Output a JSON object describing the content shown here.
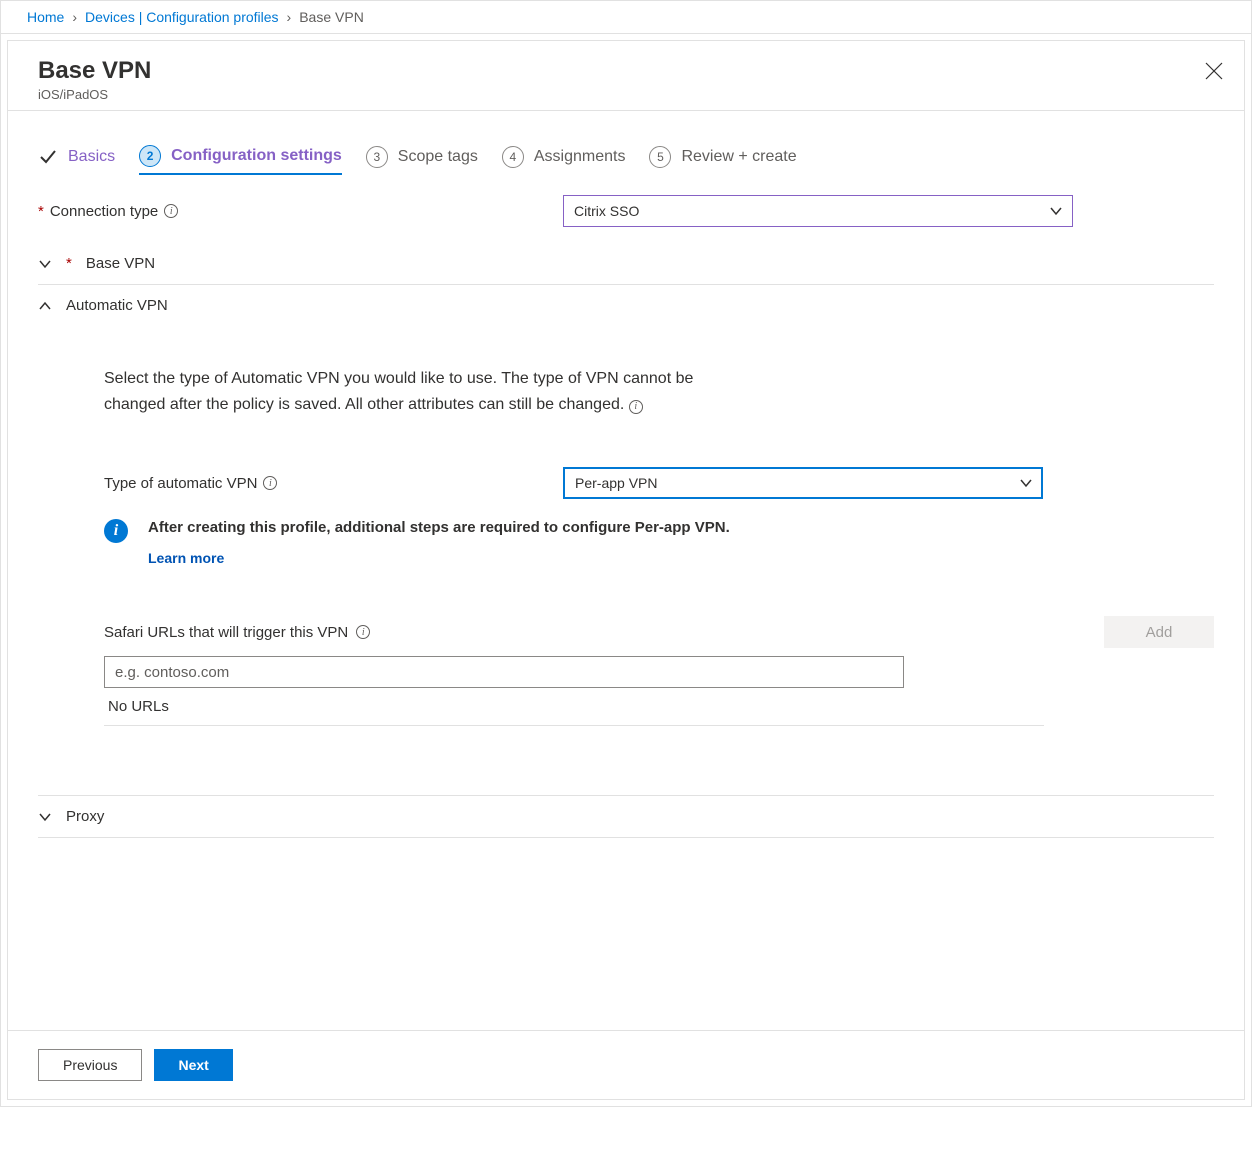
{
  "breadcrumb": {
    "items": [
      "Home",
      "Devices | Configuration profiles"
    ],
    "current": "Base VPN"
  },
  "header": {
    "title": "Base VPN",
    "subtitle": "iOS/iPadOS"
  },
  "steps": [
    {
      "label": "Basics",
      "state": "done"
    },
    {
      "num": "2",
      "label": "Configuration settings",
      "state": "active"
    },
    {
      "num": "3",
      "label": "Scope tags",
      "state": "future"
    },
    {
      "num": "4",
      "label": "Assignments",
      "state": "future"
    },
    {
      "num": "5",
      "label": "Review + create",
      "state": "future"
    }
  ],
  "connection_type": {
    "label": "Connection type",
    "value": "Citrix SSO"
  },
  "sections": {
    "base_vpn": {
      "title": "Base VPN"
    },
    "automatic_vpn": {
      "title": "Automatic VPN",
      "description": "Select the type of Automatic VPN you would like to use. The type of VPN cannot be changed after the policy is saved. All other attributes can still be changed.",
      "type_label": "Type of automatic VPN",
      "type_value": "Per-app VPN",
      "info_message": "After creating this profile, additional steps are required to configure Per-app VPN.",
      "learn_more": "Learn more",
      "safari_label": "Safari URLs that will trigger this VPN",
      "add_button": "Add",
      "url_placeholder": "e.g. contoso.com",
      "no_urls": "No URLs"
    },
    "proxy": {
      "title": "Proxy"
    }
  },
  "footer": {
    "previous": "Previous",
    "next": "Next"
  }
}
